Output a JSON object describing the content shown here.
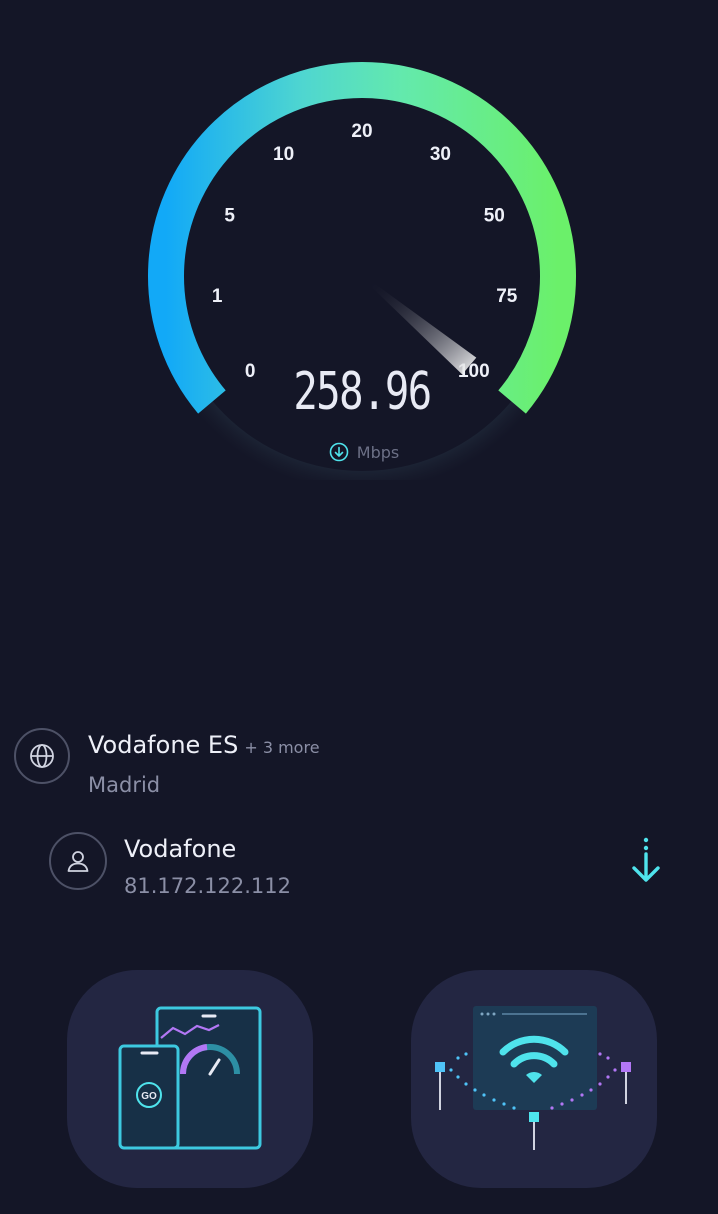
{
  "gauge": {
    "scale_labels": [
      "0",
      "1",
      "5",
      "10",
      "20",
      "30",
      "50",
      "75",
      "100"
    ],
    "speed_value": "258.96",
    "unit": "Mbps",
    "needle_level_fraction": 1.0,
    "arc_colors": {
      "start": "#1ab0f5",
      "mid": "#5fe6b4",
      "end": "#6cf26a"
    }
  },
  "server": {
    "icon": "globe-icon",
    "name": "Vodafone ES",
    "more": "+ 3 more",
    "location": "Madrid"
  },
  "provider": {
    "icon": "user-icon",
    "name": "Vodafone",
    "ip": "81.172.122.112"
  },
  "actions": {
    "download_icon": "arrow-down-icon",
    "card_left_icon": "devices-speedtest-icon",
    "card_right_icon": "wifi-network-icon",
    "go_label": "GO"
  },
  "colors": {
    "background": "#141627",
    "card": "#232642",
    "accent_cyan": "#4fe3ec",
    "accent_purple": "#b277f5"
  }
}
